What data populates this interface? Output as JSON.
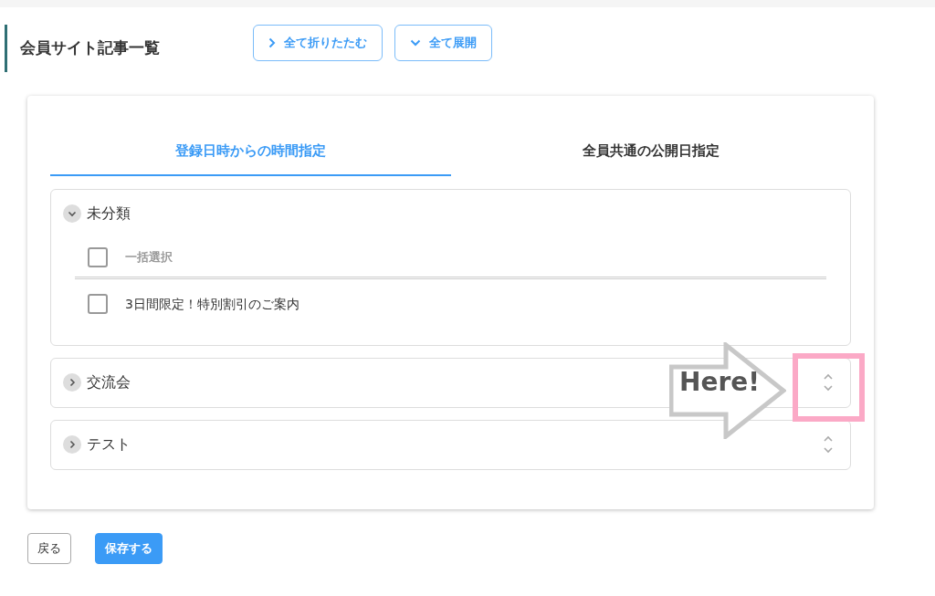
{
  "page_title": "会員サイト記事一覧",
  "toolbar_buttons": [
    {
      "label": "全て折りたたむ",
      "kind": "collapse"
    },
    {
      "label": "全て展開",
      "kind": "expand"
    }
  ],
  "tabs": [
    {
      "label": "登録日時からの時間指定",
      "selected": true
    },
    {
      "label": "全員共通の公開日指定",
      "selected": false
    }
  ],
  "categories": [
    {
      "name": "未分類",
      "expanded": true,
      "select_all": {
        "label": "一括選択",
        "checked": false
      },
      "articles": [
        {
          "title": "3日間限定！特別割引のご案内",
          "checked": false
        }
      ]
    },
    {
      "name": "交流会",
      "expanded": false
    },
    {
      "name": "テスト",
      "expanded": false
    }
  ],
  "annotation": {
    "text": "Here!"
  },
  "buttons": [
    {
      "label": "戻る",
      "kind": "secondary"
    },
    {
      "label": "保存する",
      "kind": "primary"
    }
  ]
}
